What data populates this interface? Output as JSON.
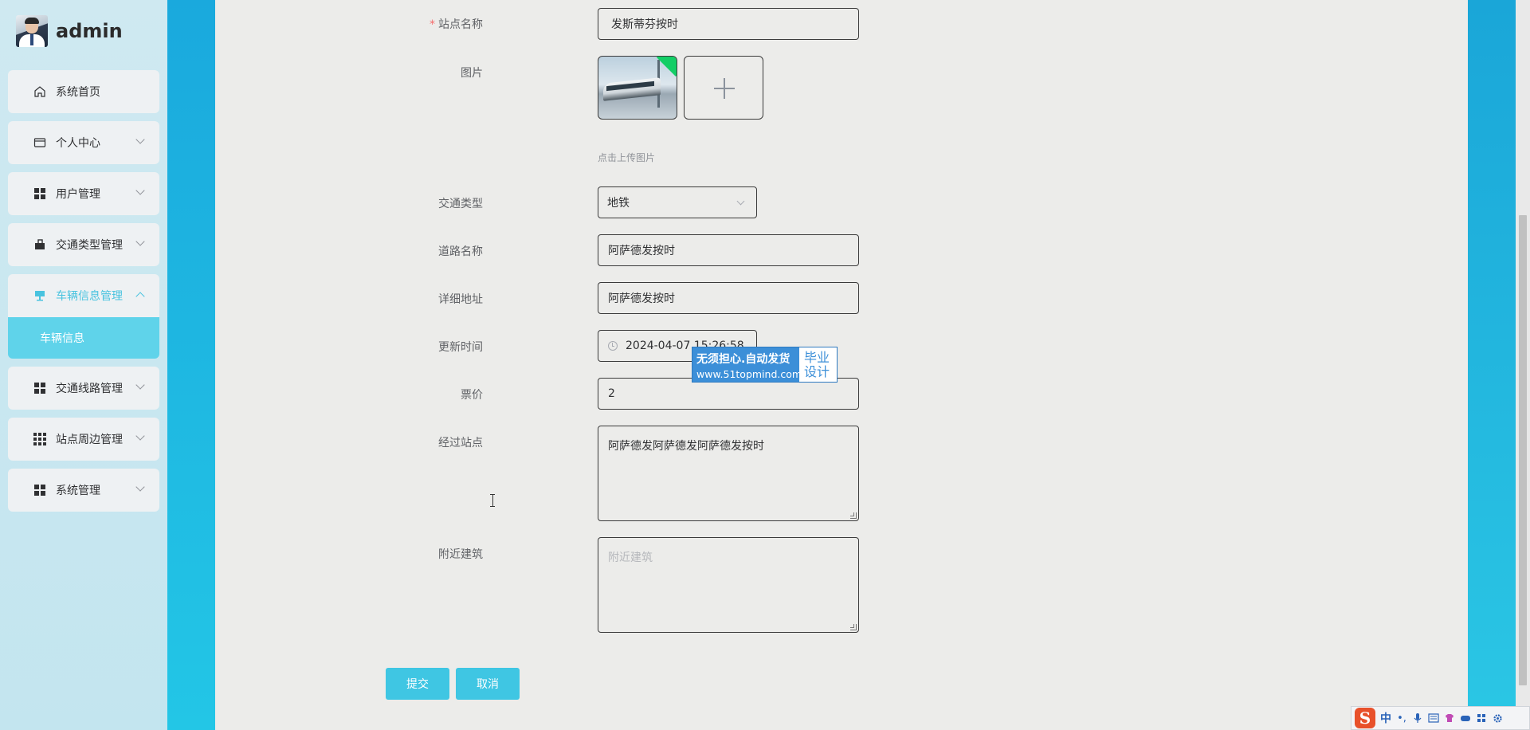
{
  "user": {
    "name": "admin"
  },
  "sidebar": {
    "items": [
      {
        "label": "系统首页",
        "icon": "home-icon"
      },
      {
        "label": "个人中心",
        "icon": "wallet-icon"
      },
      {
        "label": "用户管理",
        "icon": "grid-icon"
      },
      {
        "label": "交通类型管理",
        "icon": "briefcase-icon"
      },
      {
        "label": "车辆信息管理",
        "icon": "stand-icon"
      },
      {
        "label": "交通线路管理",
        "icon": "grid-icon"
      },
      {
        "label": "站点周边管理",
        "icon": "grid-9-icon"
      },
      {
        "label": "系统管理",
        "icon": "grid-icon"
      }
    ],
    "active_submenu": "车辆信息"
  },
  "form": {
    "station_name": {
      "label": "站点名称",
      "value": "发斯蒂芬按时"
    },
    "image": {
      "label": "图片",
      "hint": "点击上传图片"
    },
    "transport_type": {
      "label": "交通类型",
      "value": "地铁"
    },
    "road_name": {
      "label": "道路名称",
      "value": "阿萨德发按时"
    },
    "address": {
      "label": "详细地址",
      "value": "阿萨德发按时"
    },
    "update_time": {
      "label": "更新时间",
      "value": "2024-04-07 15:26:58"
    },
    "price": {
      "label": "票价",
      "value": "2"
    },
    "stations": {
      "label": "经过站点",
      "value": "阿萨德发阿萨德发阿萨德发按时"
    },
    "buildings": {
      "label": "附近建筑",
      "placeholder": "附近建筑"
    },
    "submit_label": "提交",
    "cancel_label": "取消"
  },
  "watermark": {
    "line1": "无须担心.自动发货",
    "line2": "www.51topmind.com",
    "right_line1": "毕业",
    "right_line2": "设计"
  },
  "ime": {
    "logo": "S",
    "mode": "中",
    "punct": "•,"
  }
}
